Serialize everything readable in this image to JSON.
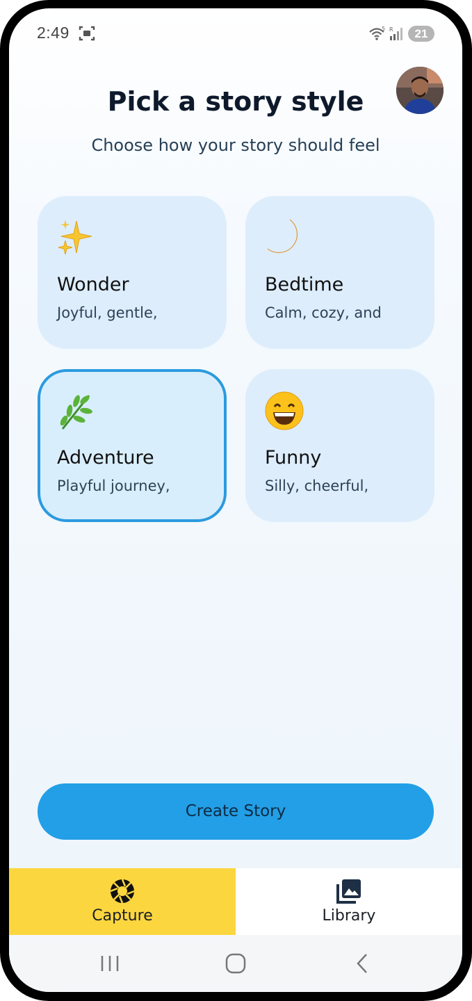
{
  "status_bar": {
    "time": "2:49",
    "battery": "21",
    "icons": [
      "screenshot-icon",
      "wifi-icon",
      "signal-icon",
      "battery-icon"
    ]
  },
  "header": {
    "title": "Pick a story style",
    "subtitle": "Choose how your story should feel",
    "avatar": "user-avatar"
  },
  "styles": [
    {
      "emoji": "✨",
      "icon": "sparkles-icon",
      "title": "Wonder",
      "description": "Joyful, gentle,",
      "selected": false
    },
    {
      "emoji": "🌙",
      "icon": "crescent-moon-icon",
      "title": "Bedtime",
      "description": "Calm, cozy, and",
      "selected": false
    },
    {
      "emoji": "🌿",
      "icon": "herb-icon",
      "title": "Adventure",
      "description": "Playful journey,",
      "selected": true
    },
    {
      "emoji": "😄",
      "icon": "grinning-face-icon",
      "title": "Funny",
      "description": "Silly, cheerful,",
      "selected": false
    }
  ],
  "create_button": {
    "label": "Create Story"
  },
  "bottom_nav": {
    "tabs": [
      {
        "label": "Capture",
        "icon": "camera-aperture-icon",
        "active": true
      },
      {
        "label": "Library",
        "icon": "photo-library-icon",
        "active": false
      }
    ]
  },
  "system_nav": {
    "buttons": [
      "recent-apps-icon",
      "home-icon",
      "back-icon"
    ]
  },
  "colors": {
    "card_bg": "#ddedfc",
    "selected_border": "#2b9adf",
    "primary_button": "#229fe6",
    "active_tab": "#fcd63f",
    "title_text": "#0e1a2b"
  }
}
